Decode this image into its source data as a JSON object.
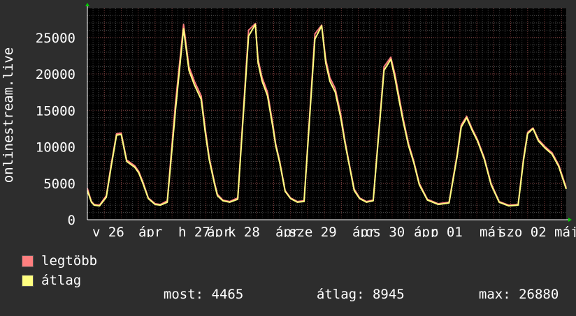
{
  "chart_data": {
    "type": "line",
    "ylabel": "onlinestream.live",
    "ylim": [
      0,
      29000
    ],
    "yticks": [
      0,
      5000,
      10000,
      15000,
      20000,
      25000
    ],
    "grid": true,
    "x_tick_labels": [
      "v 26",
      "ápr",
      "h 27",
      "ápr",
      "k 28",
      "ápr",
      "sze 29",
      "ápr",
      "cs 30",
      "ápr",
      "p 01",
      "máj",
      "szo 02",
      "máj"
    ],
    "x_range": [
      0,
      7.07
    ],
    "series": [
      {
        "name": "legtöbb",
        "color": "#ff7f7f",
        "x": [
          0,
          0.06,
          0.1,
          0.18,
          0.28,
          0.35,
          0.43,
          0.5,
          0.58,
          0.7,
          0.76,
          0.82,
          0.9,
          1,
          1.08,
          1.18,
          1.3,
          1.42,
          1.5,
          1.58,
          1.68,
          1.74,
          1.8,
          1.88,
          1.92,
          2,
          2.1,
          2.22,
          2.38,
          2.48,
          2.52,
          2.58,
          2.66,
          2.74,
          2.78,
          2.84,
          2.92,
          3,
          3.1,
          3.2,
          3.36,
          3.46,
          3.52,
          3.58,
          3.66,
          3.74,
          3.8,
          3.86,
          3.94,
          4.02,
          4.12,
          4.22,
          4.38,
          4.48,
          4.54,
          4.6,
          4.66,
          4.74,
          4.82,
          4.9,
          5.02,
          5.18,
          5.34,
          5.46,
          5.52,
          5.6,
          5.68,
          5.76,
          5.86,
          5.96,
          6.08,
          6.22,
          6.36,
          6.44,
          6.5,
          6.58,
          6.66,
          6.76,
          6.86,
          6.96,
          7.07
        ],
        "values": [
          4300,
          2500,
          2100,
          2000,
          3300,
          7500,
          11800,
          11900,
          8200,
          7400,
          6600,
          5200,
          3000,
          2200,
          2100,
          2600,
          16000,
          26800,
          21000,
          19000,
          17000,
          12500,
          8500,
          5000,
          3500,
          2700,
          2500,
          3000,
          26000,
          26900,
          22000,
          19500,
          17500,
          13000,
          10500,
          8000,
          4000,
          3000,
          2500,
          2600,
          25500,
          26700,
          22000,
          19500,
          18000,
          14500,
          11000,
          8000,
          4200,
          3000,
          2500,
          2700,
          21000,
          22300,
          20000,
          17000,
          14000,
          10500,
          8000,
          5000,
          2800,
          2200,
          2400,
          9000,
          13000,
          14200,
          12500,
          11000,
          8500,
          5000,
          2500,
          2000,
          2100,
          8500,
          12000,
          12600,
          11000,
          10000,
          9200,
          7500,
          4400
        ]
      },
      {
        "name": "átlag",
        "color": "#ffff80",
        "x": [
          0,
          0.06,
          0.1,
          0.18,
          0.28,
          0.35,
          0.43,
          0.5,
          0.58,
          0.7,
          0.76,
          0.82,
          0.9,
          1,
          1.08,
          1.18,
          1.3,
          1.42,
          1.5,
          1.58,
          1.68,
          1.74,
          1.8,
          1.88,
          1.92,
          2,
          2.1,
          2.22,
          2.38,
          2.48,
          2.52,
          2.58,
          2.66,
          2.74,
          2.78,
          2.84,
          2.92,
          3,
          3.1,
          3.2,
          3.36,
          3.46,
          3.52,
          3.58,
          3.66,
          3.74,
          3.8,
          3.86,
          3.94,
          4.02,
          4.12,
          4.22,
          4.38,
          4.48,
          4.54,
          4.6,
          4.66,
          4.74,
          4.82,
          4.9,
          5.02,
          5.18,
          5.34,
          5.46,
          5.52,
          5.6,
          5.68,
          5.76,
          5.86,
          5.96,
          6.08,
          6.22,
          6.36,
          6.44,
          6.5,
          6.58,
          6.66,
          6.76,
          6.86,
          6.96,
          7.07
        ],
        "values": [
          4000,
          2400,
          2000,
          1900,
          3100,
          7200,
          11600,
          11700,
          8000,
          7200,
          6400,
          5000,
          2900,
          2100,
          2000,
          2400,
          15000,
          26200,
          20500,
          18500,
          16500,
          12000,
          8200,
          4800,
          3300,
          2600,
          2400,
          2800,
          25200,
          26800,
          21500,
          19000,
          17000,
          12600,
          10200,
          7800,
          3900,
          2900,
          2400,
          2500,
          24800,
          26600,
          21500,
          19000,
          17500,
          14000,
          10700,
          7800,
          4000,
          2900,
          2400,
          2600,
          20500,
          22000,
          19500,
          16500,
          13600,
          10200,
          7800,
          4800,
          2700,
          2100,
          2300,
          8700,
          12700,
          14000,
          12300,
          10800,
          8300,
          4800,
          2400,
          1900,
          2000,
          8200,
          11800,
          12500,
          10800,
          9800,
          9000,
          7300,
          4200
        ]
      }
    ]
  },
  "legend": {
    "items": [
      {
        "label": "legtöbb",
        "color": "#ff7f7f"
      },
      {
        "label": "átlag",
        "color": "#ffff80"
      }
    ]
  },
  "stats": {
    "now": {
      "label": "most:",
      "value": "4465"
    },
    "avg": {
      "label": "átlag:",
      "value": "8945"
    },
    "max": {
      "label": "max:",
      "value": "26880"
    }
  }
}
